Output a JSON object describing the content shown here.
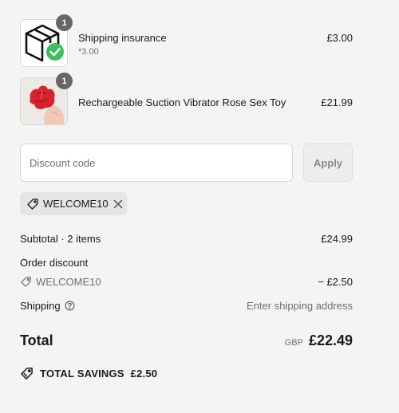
{
  "line_items": [
    {
      "name": "Shipping insurance",
      "subtitle": "*3.00",
      "price": "£3.00",
      "quantity": "1",
      "image_icon": "box-shield-icon"
    },
    {
      "name": "Rechargeable Suction Vibrator Rose Sex Toy",
      "subtitle": "",
      "price": "£21.99",
      "quantity": "1",
      "image_icon": "product-photo"
    }
  ],
  "discount": {
    "placeholder": "Discount code",
    "apply_label": "Apply",
    "applied_code": "WELCOME10"
  },
  "summary": {
    "subtotal_label": "Subtotal · 2 items",
    "subtotal_value": "£24.99",
    "order_discount_label": "Order discount",
    "order_discount_code": "WELCOME10",
    "order_discount_value": "− £2.50",
    "shipping_label": "Shipping",
    "shipping_value": "Enter shipping address",
    "total_label": "Total",
    "currency": "GBP",
    "total_value": "£22.49",
    "savings_label": "TOTAL SAVINGS",
    "savings_value": "£2.50"
  },
  "colors": {
    "background": "#f4f4f4",
    "badge": "#666666",
    "check_green": "#3dbf5a",
    "rose_red": "#d7232e"
  }
}
